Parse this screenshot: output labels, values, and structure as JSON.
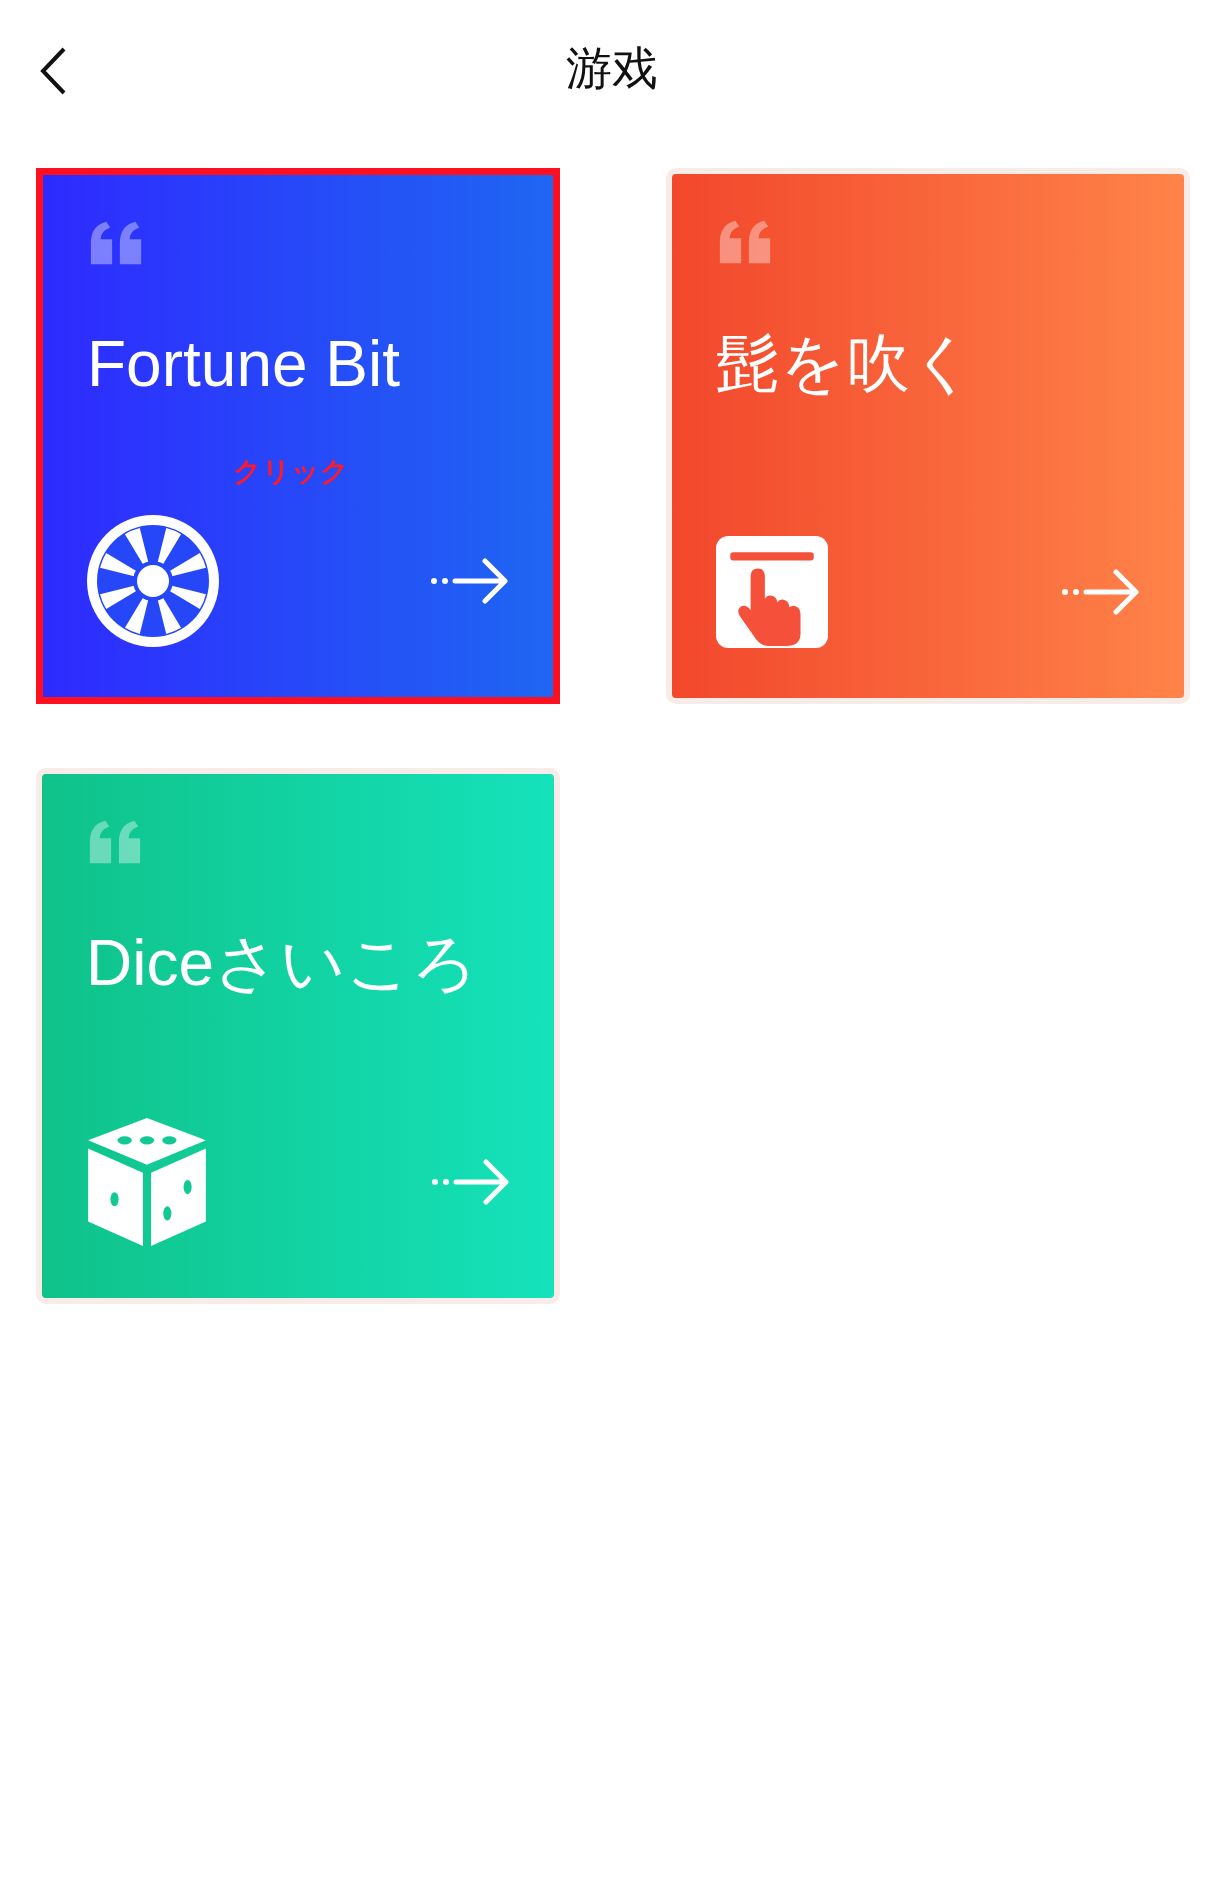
{
  "header": {
    "title": "游戏"
  },
  "cards": [
    {
      "title": "Fortune Bit",
      "kind": "wheel",
      "highlighted": true,
      "annotation": "クリック"
    },
    {
      "title": "髭を吹く",
      "kind": "tap",
      "highlighted": false
    },
    {
      "title": "Diceさいころ",
      "kind": "dice",
      "highlighted": false
    }
  ]
}
